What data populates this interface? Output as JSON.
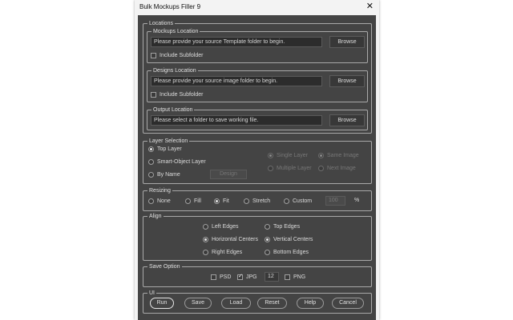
{
  "window": {
    "title": "Bulk Mockups Filler 9",
    "close": "✕"
  },
  "locations": {
    "label": "Locations",
    "mockups": {
      "label": "Mockups Location",
      "placeholder": "Please provide your source Template folder to begin.",
      "browse": "Browse",
      "subfolder": "Include Subfolder",
      "subfolder_checked": false
    },
    "designs": {
      "label": "Designs Location",
      "placeholder": "Please provide your source image folder to begin.",
      "browse": "Browse",
      "subfolder": "Include Subfolder",
      "subfolder_checked": false
    },
    "output": {
      "label": "Output Location",
      "placeholder": "Please select a folder to save working file.",
      "browse": "Browse"
    }
  },
  "layer_selection": {
    "label": "Layer Selection",
    "top_layer": "Top Layer",
    "smart_object": "Smart-Object Layer",
    "by_name": "By Name",
    "design_btn": "Design",
    "single_layer": "Single Layer",
    "same_image": "Same Image",
    "multiple_layer": "Multiple Layer",
    "next_image": "Next Image",
    "selected": "top_layer"
  },
  "resizing": {
    "label": "Resizing",
    "none": "None",
    "fill": "Fill",
    "fit": "Fit",
    "stretch": "Stretch",
    "custom": "Custom",
    "custom_value": "100",
    "percent": "%",
    "selected": "fit"
  },
  "align": {
    "label": "Align",
    "left": "Left Edges",
    "top": "Top Edges",
    "hcenter": "Horizontal Centers",
    "vcenter": "Vertical Centers",
    "right": "Right Edges",
    "bottom": "Bottom Edges",
    "selected": [
      "hcenter",
      "vcenter"
    ]
  },
  "save_option": {
    "label": "Save Option",
    "psd": "PSD",
    "jpg": "JPG",
    "jpg_quality": "12",
    "png": "PNG",
    "psd_checked": false,
    "jpg_checked": true,
    "png_checked": false
  },
  "ui": {
    "label": "UI",
    "run": "Run",
    "save": "Save",
    "load": "Load",
    "reset": "Reset",
    "help": "Help",
    "cancel": "Cancel"
  }
}
